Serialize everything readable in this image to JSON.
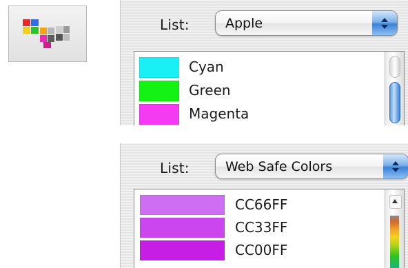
{
  "toolbar": {
    "icon": "color-palettes-icon"
  },
  "panel_apple": {
    "list_label": "List:",
    "popup_value": "Apple",
    "rows": [
      {
        "name": "Cyan",
        "color": "#18f0f6"
      },
      {
        "name": "Green",
        "color": "#14f214"
      },
      {
        "name": "Magenta",
        "color": "#f43bf2"
      }
    ]
  },
  "panel_web": {
    "list_label": "List:",
    "popup_value": "Web Safe Colors",
    "rows": [
      {
        "name": "CC66FF",
        "color": "#ce6ff3"
      },
      {
        "name": "CC33FF",
        "color": "#cc46f0"
      },
      {
        "name": "CC00FF",
        "color": "#c71ee6"
      }
    ]
  },
  "colors": {
    "accent": "#3b82d8",
    "panel_bg": "#ececec"
  }
}
